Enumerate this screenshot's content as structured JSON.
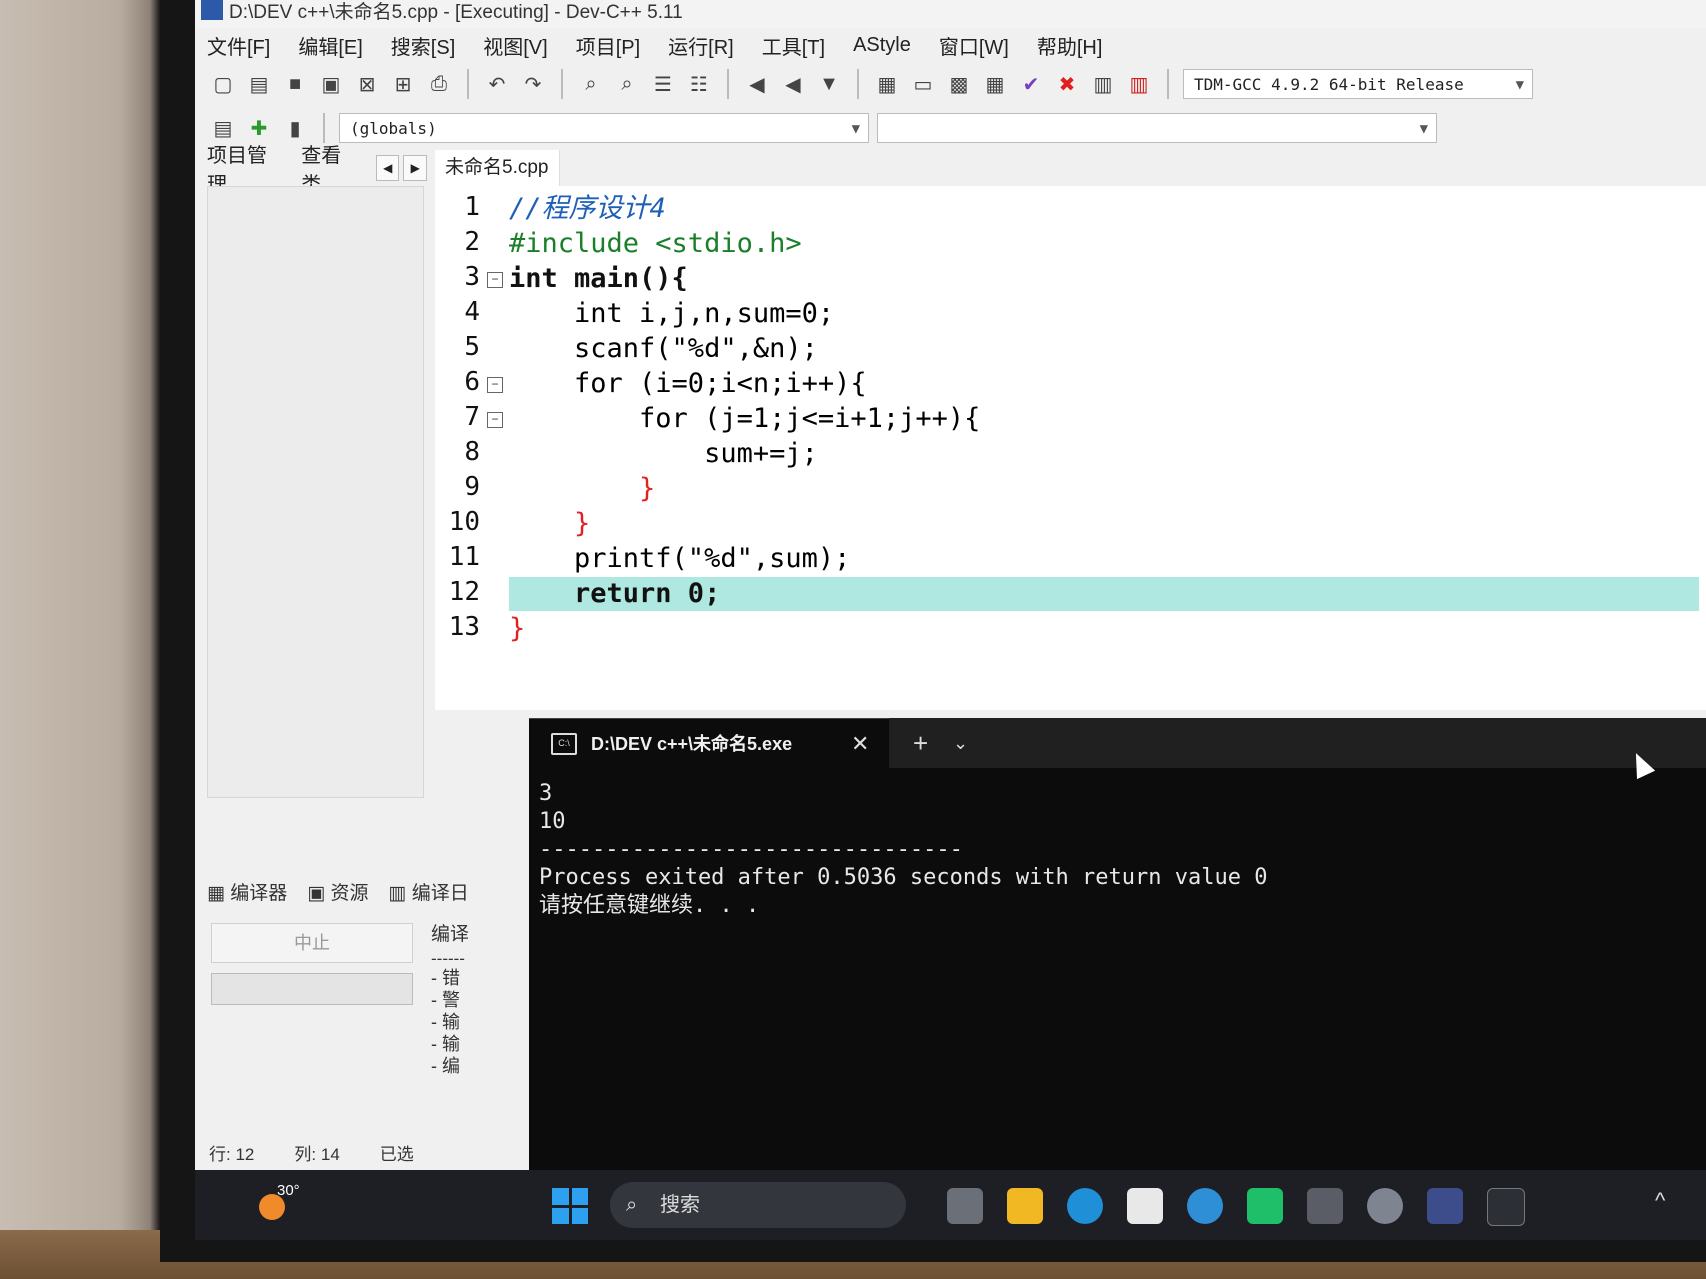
{
  "window": {
    "title": "D:\\DEV c++\\未命名5.cpp - [Executing] - Dev-C++ 5.11"
  },
  "menu": [
    "文件[F]",
    "编辑[E]",
    "搜索[S]",
    "视图[V]",
    "项目[P]",
    "运行[R]",
    "工具[T]",
    "AStyle",
    "窗口[W]",
    "帮助[H]"
  ],
  "toolbar": {
    "globals": "(globals)",
    "compiler": "TDM-GCC 4.9.2 64-bit Release"
  },
  "left_panel": {
    "tabs": [
      "项目管理",
      "查看类"
    ]
  },
  "editor": {
    "file_tab": "未命名5.cpp",
    "line_numbers": [
      "1",
      "2",
      "3",
      "4",
      "5",
      "6",
      "7",
      "8",
      "9",
      "10",
      "11",
      "12",
      "13"
    ],
    "lines": [
      "//程序设计4",
      "#include <stdio.h>",
      "int main(){",
      "    int i,j,n,sum=0;",
      "    scanf(\"%d\",&n);",
      "    for (i=0;i<n;i++){",
      "        for (j=1;j<=i+1;j++){",
      "            sum+=j;",
      "        }",
      "    }",
      "    printf(\"%d\",sum);",
      "    return 0;",
      "}"
    ],
    "highlight_line": 12
  },
  "bottom_panel": {
    "tabs": [
      "编译器",
      "资源",
      "编译日"
    ],
    "stop": "中止",
    "log_header": "编译",
    "log_items": [
      "- 错",
      "- 警",
      "- 输",
      "- 输",
      "- 编"
    ]
  },
  "statusbar": {
    "row_label": "行:",
    "row": "12",
    "col_label": "列:",
    "col": "14",
    "sel_label": "已选"
  },
  "terminal": {
    "tab_title": "D:\\DEV c++\\未命名5.exe",
    "icon_text": "C:\\",
    "close": "✕",
    "plus": "+",
    "chevron": "⌄",
    "output": "3\n10\n--------------------------------\nProcess exited after 0.5036 seconds with return value 0\n请按任意键继续. . ."
  },
  "taskbar": {
    "weather_temp": "30°",
    "search_placeholder": "搜索",
    "search_icon": "⌕",
    "chevron_up": "^"
  }
}
